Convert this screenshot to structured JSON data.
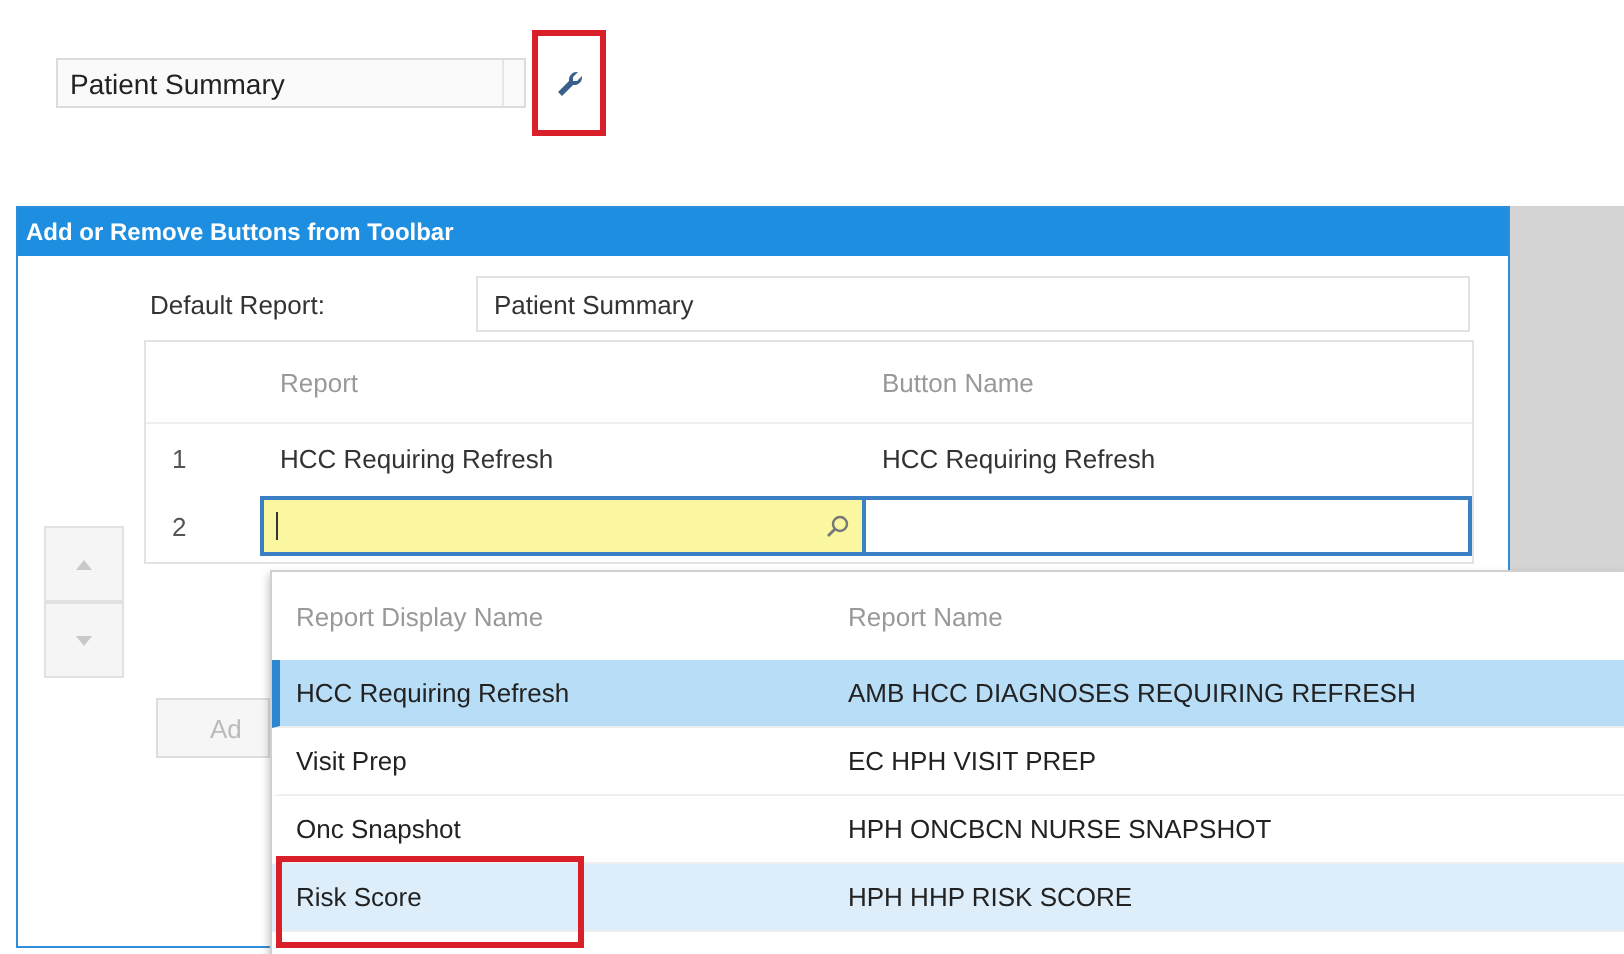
{
  "toolbar": {
    "report_select": "Patient Summary",
    "settings_button": {
      "annotated": true
    }
  },
  "dialog": {
    "title": "Add or Remove Buttons from Toolbar",
    "default_report_label": "Default Report:",
    "default_report_value": "Patient Summary",
    "grid": {
      "columns": [
        "Report",
        "Button Name"
      ],
      "rows": [
        {
          "number": "1",
          "report": "HCC Requiring Refresh",
          "button_name": "HCC Requiring Refresh",
          "editing": false
        },
        {
          "number": "2",
          "editing": true
        }
      ]
    },
    "add_button": "Ad"
  },
  "dropdown": {
    "columns": [
      "Report Display Name",
      "Report Name"
    ],
    "rows": [
      {
        "display_name": "HCC Requiring Refresh",
        "report_name": "AMB HCC DIAGNOSES REQUIRING REFRESH",
        "selected": true,
        "hovered": false,
        "annotated": false
      },
      {
        "display_name": "Visit Prep",
        "report_name": "EC HPH VISIT PREP",
        "selected": false,
        "hovered": false,
        "annotated": false
      },
      {
        "display_name": "Onc Snapshot",
        "report_name": "HPH ONCBCN NURSE SNAPSHOT",
        "selected": false,
        "hovered": false,
        "annotated": false
      },
      {
        "display_name": "Risk Score",
        "report_name": "HPH HHP RISK SCORE",
        "selected": false,
        "hovered": true,
        "annotated": true
      }
    ]
  }
}
